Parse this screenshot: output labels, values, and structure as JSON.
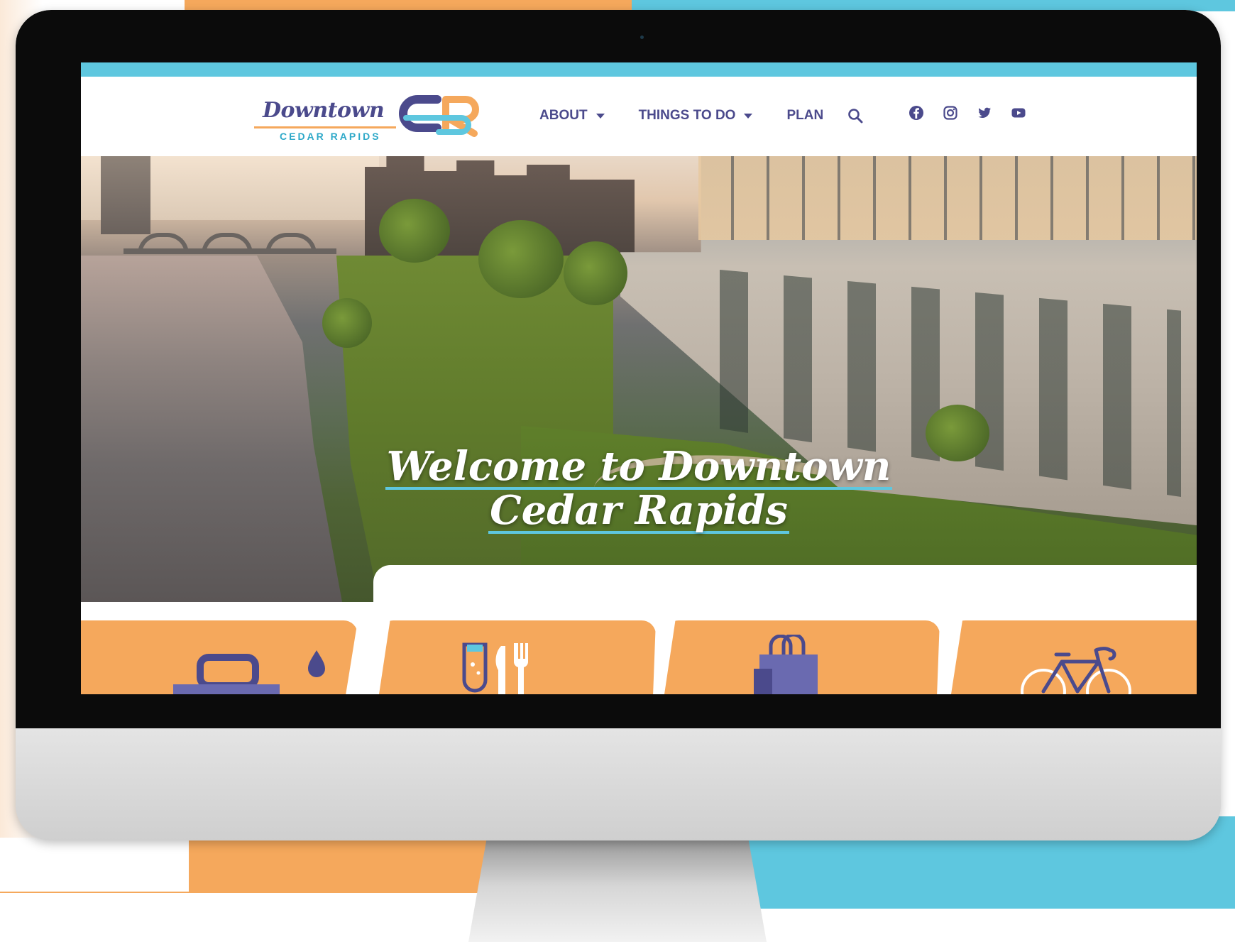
{
  "site": {
    "logo": {
      "word": "Downtown",
      "sub": "CEDAR RAPIDS"
    },
    "nav": [
      {
        "label": "ABOUT",
        "dropdown": true
      },
      {
        "label": "THINGS TO DO",
        "dropdown": true
      },
      {
        "label": "PLAN",
        "dropdown": false
      }
    ],
    "icons": {
      "search": "search-icon",
      "social": [
        "facebook-icon",
        "instagram-icon",
        "twitter-icon",
        "youtube-icon"
      ]
    },
    "hero": {
      "title_line1": "Welcome to Downtown",
      "title_line2": "Cedar Rapids"
    },
    "cards": [
      {
        "icon": "suitcase-icon"
      },
      {
        "icon": "dining-icon"
      },
      {
        "icon": "shopping-bag-icon"
      },
      {
        "icon": "bicycle-icon"
      }
    ],
    "colors": {
      "brand_purple": "#4b4a8c",
      "brand_blue": "#5ec7df",
      "brand_orange": "#f5a85c"
    }
  }
}
